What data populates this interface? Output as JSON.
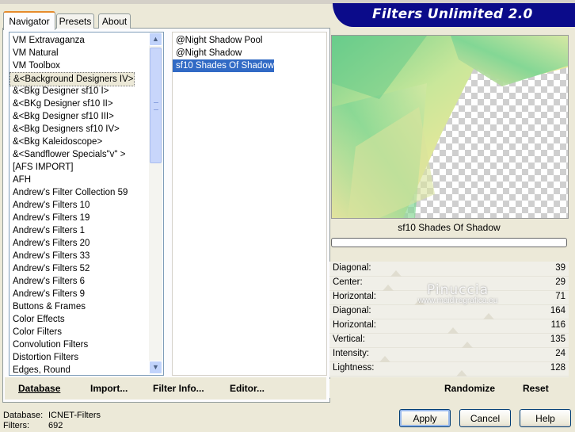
{
  "banner": {
    "title": "Filters Unlimited 2.0"
  },
  "tabs": [
    {
      "label": "Navigator"
    },
    {
      "label": "Presets"
    },
    {
      "label": "About"
    }
  ],
  "categories": [
    "VM Extravaganza",
    "VM Natural",
    "VM Toolbox",
    "&<Background Designers IV>",
    "&<Bkg Designer sf10 I>",
    "&<BKg Designer sf10 II>",
    "&<Bkg Designer sf10 III>",
    "&<Bkg Designers sf10 IV>",
    "&<Bkg Kaleidoscope>",
    "&<Sandflower Specials\"v\" >",
    "[AFS IMPORT]",
    "AFH",
    "Andrew's Filter Collection 59",
    "Andrew's Filters 10",
    "Andrew's Filters 19",
    "Andrew's Filters 1",
    "Andrew's Filters 20",
    "Andrew's Filters 33",
    "Andrew's Filters 52",
    "Andrew's Filters 6",
    "Andrew's Filters 9",
    "Buttons & Frames",
    "Color Effects",
    "Color Filters",
    "Convolution Filters",
    "Distortion Filters",
    "Edges, Round"
  ],
  "filters": [
    "@Night Shadow Pool",
    "@Night Shadow",
    "sf10 Shades Of Shadow"
  ],
  "nav_buttons": {
    "database": "Database",
    "import": "Import...",
    "filter_info": "Filter Info...",
    "editor": "Editor..."
  },
  "preview": {
    "filter_name": "sf10 Shades Of Shadow"
  },
  "params": [
    {
      "label": "Diagonal:",
      "value": "39"
    },
    {
      "label": "Center:",
      "value": "29"
    },
    {
      "label": "Horizontal:",
      "value": "71"
    },
    {
      "label": "Diagonal:",
      "value": "164"
    },
    {
      "label": "Horizontal:",
      "value": "116"
    },
    {
      "label": "Vertical:",
      "value": "135"
    },
    {
      "label": "Intensity:",
      "value": "24"
    },
    {
      "label": "Lightness:",
      "value": "128"
    }
  ],
  "param_levels": [
    39,
    29,
    71,
    164,
    116,
    135,
    24,
    128
  ],
  "param_max": 255,
  "watermark": {
    "line1": "Pinuccia",
    "line2": "www.maidiregrafica.eu"
  },
  "right_buttons": {
    "randomize": "Randomize",
    "reset": "Reset"
  },
  "status": {
    "db_label": "Database:",
    "db_value": "ICNET-Filters",
    "count_label": "Filters:",
    "count_value": "692"
  },
  "dialog_buttons": {
    "apply": "Apply",
    "cancel": "Cancel",
    "help": "Help"
  },
  "colors": {
    "banner": "#0b0b8a",
    "selection": "#316ac5",
    "tab_accent": "#e68b2c"
  }
}
